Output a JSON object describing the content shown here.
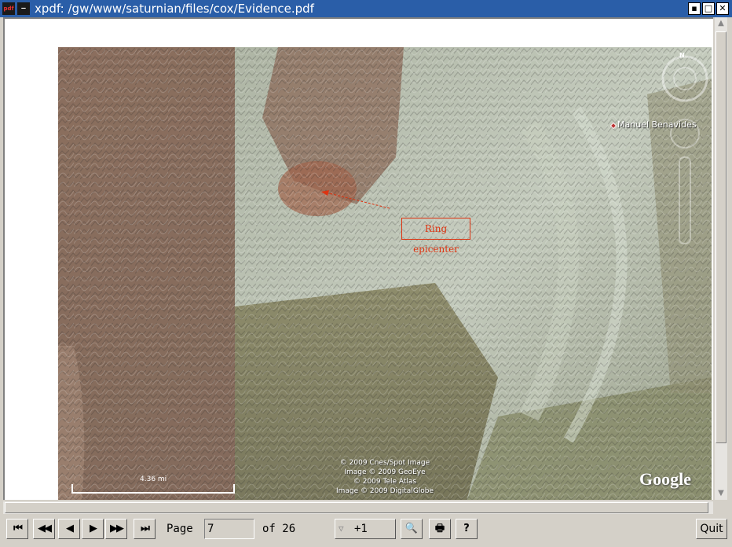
{
  "window": {
    "title": "xpdf: /gw/www/saturnian/files/cox/Evidence.pdf",
    "app_icon_label": "pdf",
    "menu_icon_label": "—",
    "controls": {
      "minimize": "▪",
      "maximize": "□",
      "close": "✕"
    }
  },
  "document": {
    "map": {
      "caption": "Ring epicenter",
      "place_label": "Manuel Benavides",
      "compass_label": "N",
      "scale_label": "4.36 mi",
      "brand": "Google",
      "credits": [
        "© 2009 Cnes/Spot Image",
        "Image © 2009 GeoEye",
        "© 2009 Tele Atlas",
        "Image © 2009 DigitalGlobe"
      ]
    }
  },
  "toolbar": {
    "first_page_icon": "⏮",
    "prev_ten_icon": "◀◀",
    "prev_page_icon": "◀",
    "next_page_icon": "▶",
    "next_ten_icon": "▶▶",
    "last_page_icon": "⏭",
    "page_label": "Page",
    "page_value": "7",
    "of_label": "of 26",
    "zoom_value": "+1",
    "find_icon": "🔍",
    "print_icon": "🖶",
    "help_label": "?",
    "quit_label": "Quit"
  },
  "colors": {
    "titlebar": "#2a5ea8",
    "chrome": "#d4d0c8",
    "caption_red": "#d31"
  }
}
